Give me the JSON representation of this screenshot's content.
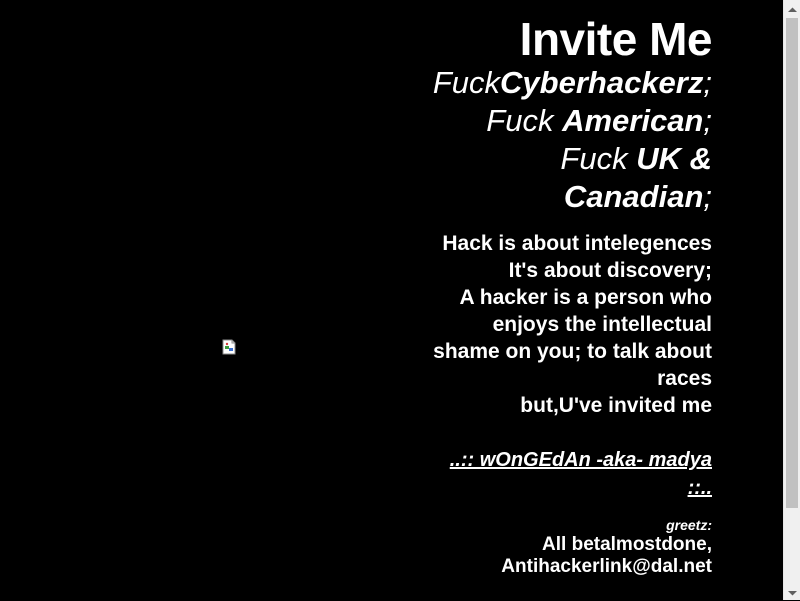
{
  "page": {
    "title": "Invite Me",
    "lines": [
      {
        "a": "Fuck",
        "b": "Cyberhackerz",
        "c": ";"
      },
      {
        "a": "Fuck ",
        "b": "American",
        "c": ";"
      },
      {
        "a": "Fuck ",
        "b": "UK &",
        "c": ""
      },
      {
        "a": "",
        "b": "Canadian",
        "c": ";"
      }
    ],
    "body_lines": [
      "Hack is about intelegences",
      "It's about discovery;",
      "A hacker is a person who",
      "enjoys the intellectual",
      "shame on you; to talk about",
      "races",
      "but,U've invited me"
    ],
    "author_line1": "..:: wOnGEdAn -aka- madya",
    "author_line2": "::..",
    "greetz_label": "greetz:",
    "greetz_lines": [
      "All betalmostdone,",
      "Antihackerlink@dal.net"
    ]
  },
  "colors": {
    "background": "#000000",
    "text": "#ffffff",
    "scrollbar_track": "#f0f0f0",
    "scrollbar_thumb": "#c1c1c1"
  },
  "icons": {
    "broken_image": "broken-image-icon",
    "scroll_up": "arrow-up-icon",
    "scroll_down": "arrow-down-icon"
  }
}
